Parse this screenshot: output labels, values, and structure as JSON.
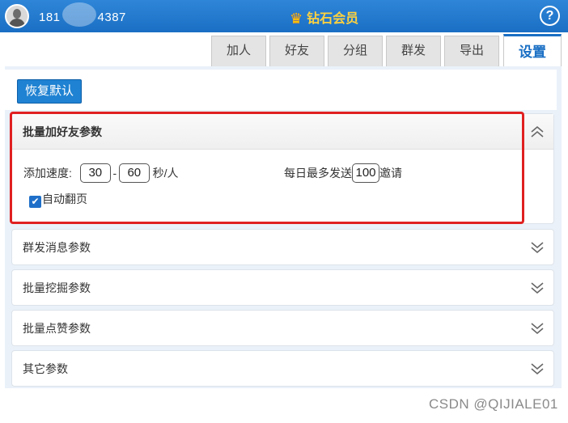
{
  "header": {
    "phone_prefix": "181",
    "phone_suffix": "4387",
    "title": "钻石会员",
    "help_label": "?"
  },
  "tabs": [
    {
      "label": "加人"
    },
    {
      "label": "好友"
    },
    {
      "label": "分组"
    },
    {
      "label": "群发"
    },
    {
      "label": "导出"
    },
    {
      "label": "设置",
      "active": true
    }
  ],
  "toolbar": {
    "reset_label": "恢复默认"
  },
  "panels": {
    "add_friends": {
      "title": "批量加好友参数",
      "speed_label": "添加速度:",
      "speed_min": "30",
      "speed_sep": "-",
      "speed_max": "60",
      "speed_unit": "秒/人",
      "daily_label": "每日最多发送",
      "daily_value": "100",
      "daily_unit": "邀请",
      "auto_page_label": "自动翻页",
      "auto_page_checked": true
    },
    "group_message": {
      "title": "群发消息参数"
    },
    "batch_mining": {
      "title": "批量挖掘参数"
    },
    "batch_like": {
      "title": "批量点赞参数"
    },
    "other": {
      "title": "其它参数"
    }
  },
  "watermark": "CSDN @QIJIALE01",
  "colors": {
    "header_blue": "#1a6fc4",
    "accent_blue": "#1f82d2",
    "highlight_red": "#e02020",
    "title_gold": "#ffd23f"
  }
}
